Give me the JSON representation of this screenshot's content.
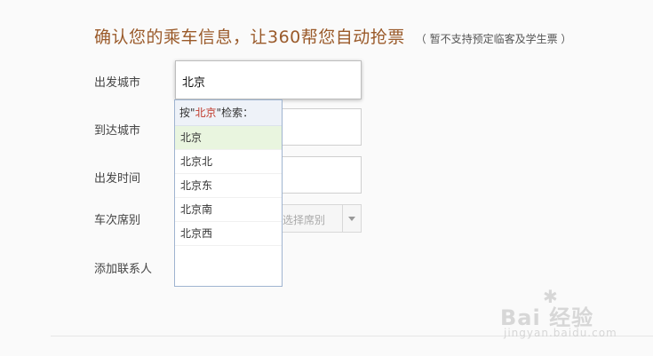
{
  "form": {
    "title": "确认您的乘车信息，让360帮您自动抢票",
    "title_note": "（ 暂不支持预定临客及学生票 ）",
    "from_label": "出发城市",
    "from_value": "北京",
    "to_label": "到达城市",
    "date_label": "出发时间",
    "seat_label": "车次席别",
    "seat_placeholder": "选择席别",
    "contact_label": "添加联系人"
  },
  "suggest": {
    "head_prefix": "按\"",
    "head_keyword": "北京",
    "head_suffix": "\"检索：",
    "items": [
      "北京",
      "北京北",
      "北京东",
      "北京南",
      "北京西"
    ]
  },
  "watermark": {
    "brand": "Bai 经验",
    "url": "jingyan.baidu.com"
  }
}
